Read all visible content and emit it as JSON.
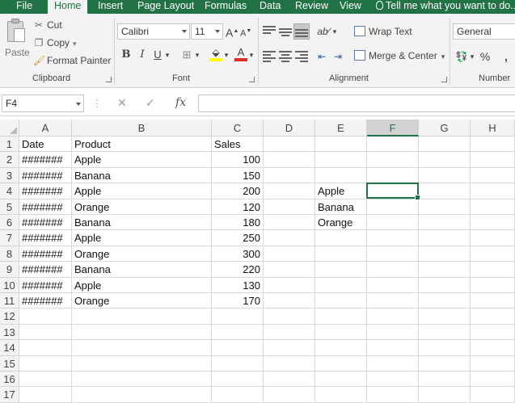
{
  "menu": {
    "tabs": [
      "File",
      "Home",
      "Insert",
      "Page Layout",
      "Formulas",
      "Data",
      "Review",
      "View"
    ],
    "active": "Home",
    "tell_me": "Tell me what you want to do..."
  },
  "ribbon": {
    "clipboard": {
      "paste": "Paste",
      "cut": "Cut",
      "copy": "Copy",
      "format_painter": "Format Painter",
      "label": "Clipboard"
    },
    "font": {
      "name": "Calibri",
      "size": "11",
      "label": "Font"
    },
    "alignment": {
      "wrap_text": "Wrap Text",
      "merge_center": "Merge & Center",
      "label": "Alignment"
    },
    "number": {
      "format": "General",
      "label": "Number"
    }
  },
  "formula_bar": {
    "name_box": "F4",
    "content": ""
  },
  "grid": {
    "columns": [
      "A",
      "B",
      "C",
      "D",
      "E",
      "F",
      "G",
      "H"
    ],
    "selected_column": "F",
    "rows": [
      "1",
      "2",
      "3",
      "4",
      "5",
      "6",
      "7",
      "8",
      "9",
      "10",
      "11",
      "12",
      "13",
      "14",
      "15",
      "16",
      "17"
    ],
    "active_cell": "F4",
    "cells": {
      "A": [
        "Date",
        "#######",
        "#######",
        "#######",
        "#######",
        "#######",
        "#######",
        "#######",
        "#######",
        "#######",
        "#######"
      ],
      "B": [
        "Product",
        "Apple",
        "Banana",
        "Apple",
        "Orange",
        "Banana",
        "Apple",
        "Orange",
        "Banana",
        "Apple",
        "Orange"
      ],
      "C_header": "Sales",
      "C": [
        "100",
        "150",
        "200",
        "120",
        "180",
        "250",
        "300",
        "220",
        "130",
        "170"
      ],
      "E": [
        "Apple",
        "Banana",
        "Orange"
      ]
    }
  },
  "colors": {
    "accent": "#217346",
    "ribbon_bg": "#f3f3f3",
    "gridline": "#dadada"
  }
}
